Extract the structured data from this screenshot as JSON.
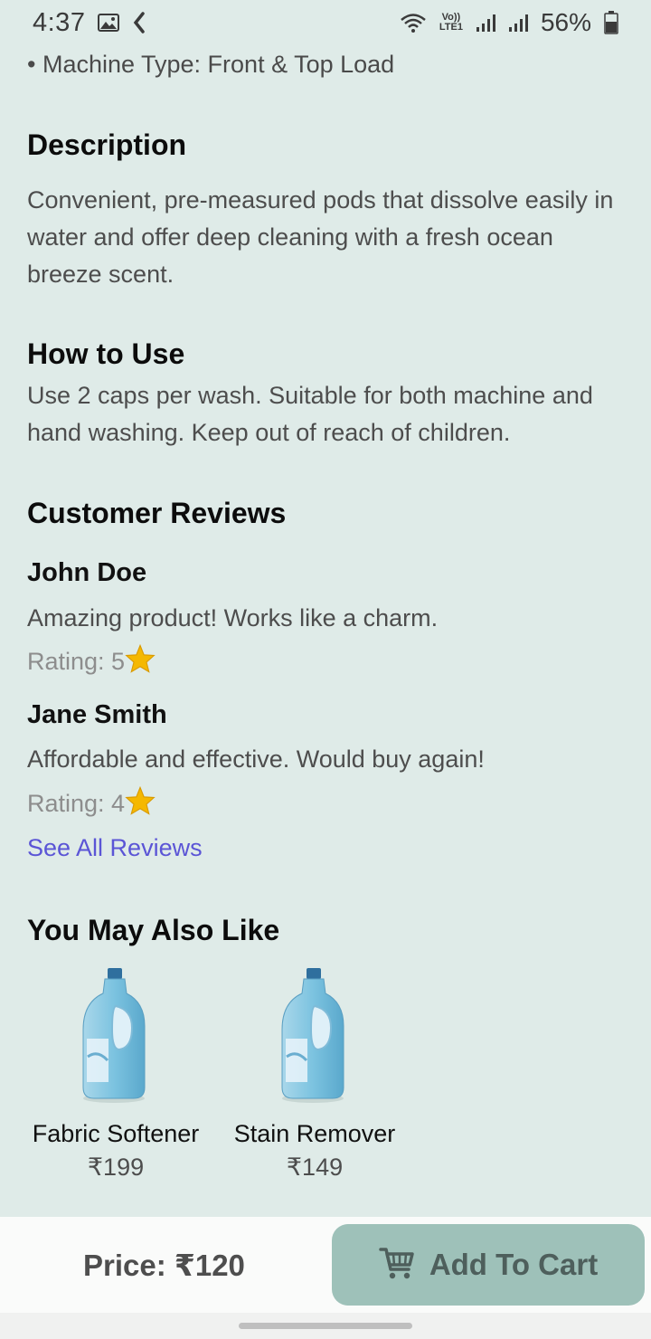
{
  "status_bar": {
    "time": "4:37",
    "network_label_top": "Vo))",
    "network_label_bottom": "LTE1",
    "battery_percent": "56%"
  },
  "specs": {
    "machine_type": "• Machine Type: Front & Top Load"
  },
  "description": {
    "title": "Description",
    "text": "Convenient, pre-measured pods that dissolve easily in water and offer deep cleaning with a fresh ocean breeze scent."
  },
  "how_to_use": {
    "title": "How to Use",
    "text": "Use 2 caps per wash. Suitable for both machine and hand washing. Keep out of reach of children."
  },
  "reviews": {
    "title": "Customer Reviews",
    "items": [
      {
        "name": "John Doe",
        "text": "Amazing product! Works like a charm.",
        "rating_label": "Rating: 5"
      },
      {
        "name": "Jane Smith",
        "text": "Affordable and effective. Would buy again!",
        "rating_label": "Rating: 4"
      }
    ],
    "see_all": "See All Reviews"
  },
  "related": {
    "title": "You May Also Like",
    "products": [
      {
        "name": "Fabric Softener",
        "price": "₹199"
      },
      {
        "name": "Stain Remover",
        "price": "₹149"
      }
    ]
  },
  "bottom_bar": {
    "price_label": "Price: ₹120",
    "cart_button_label": "Add To Cart"
  },
  "colors": {
    "background": "#DFEBE8",
    "button": "#9EC1B9",
    "link": "#5B55D6",
    "star": "#F5B800"
  },
  "icons": {
    "gallery": "image-icon",
    "wifi": "wifi-icon",
    "signal": "signal-icon",
    "battery": "battery-icon",
    "star": "star-icon",
    "cart": "cart-icon"
  }
}
